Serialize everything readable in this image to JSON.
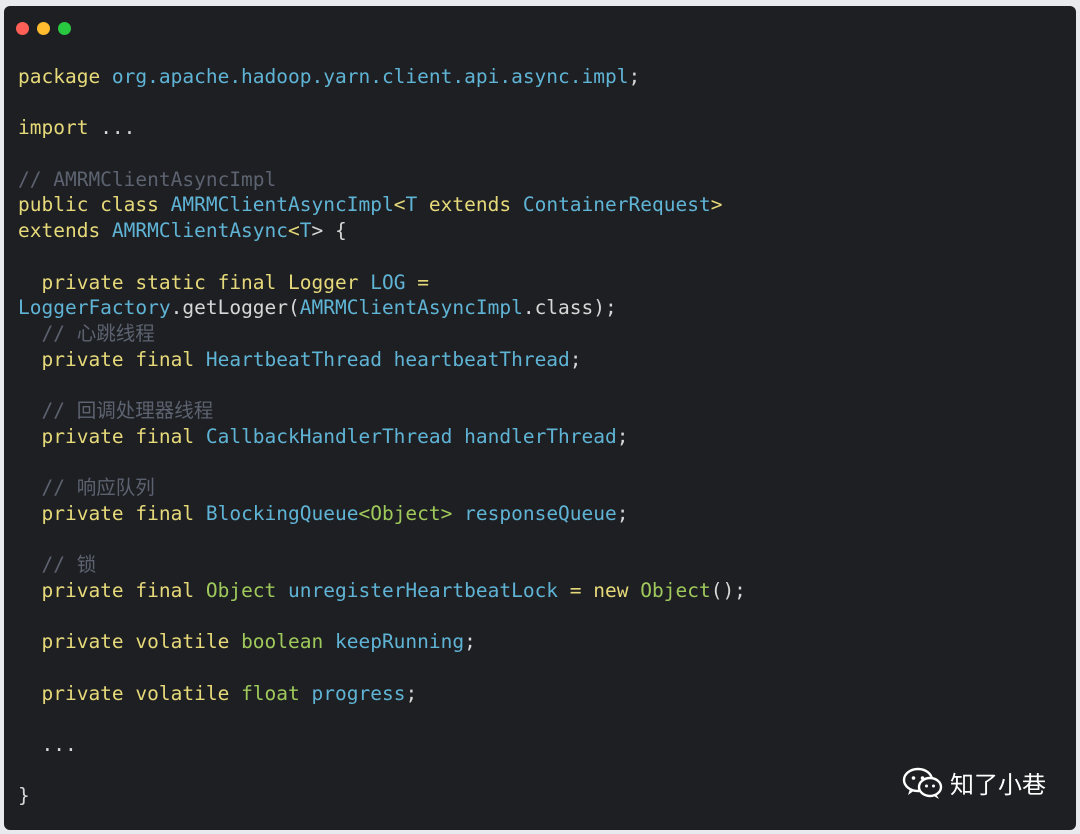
{
  "window": {
    "controls": [
      "close",
      "minimize",
      "zoom"
    ]
  },
  "code": {
    "lines": [
      [
        {
          "t": "package ",
          "c": "kw"
        },
        {
          "t": "org.apache.hadoop.yarn.client.api.async.impl",
          "c": "ty"
        },
        {
          "t": ";",
          "c": "pl"
        }
      ],
      [],
      [
        {
          "t": "import ",
          "c": "kw"
        },
        {
          "t": "...",
          "c": "pl"
        }
      ],
      [],
      [
        {
          "t": "// AMRMClientAsyncImpl",
          "c": "cm"
        }
      ],
      [
        {
          "t": "public class ",
          "c": "kw"
        },
        {
          "t": "AMRMClientAsyncImpl",
          "c": "ty"
        },
        {
          "t": "<",
          "c": "kw"
        },
        {
          "t": "T ",
          "c": "ty"
        },
        {
          "t": "extends ",
          "c": "kw"
        },
        {
          "t": "ContainerRequest",
          "c": "ty"
        },
        {
          "t": ">",
          "c": "kw"
        }
      ],
      [
        {
          "t": "extends ",
          "c": "kw"
        },
        {
          "t": "AMRMClientAsync",
          "c": "ty"
        },
        {
          "t": "<",
          "c": "kw"
        },
        {
          "t": "T",
          "c": "ty"
        },
        {
          "t": "> {",
          "c": "pl"
        }
      ],
      [],
      [
        {
          "t": "  private static final ",
          "c": "kw"
        },
        {
          "t": "Logger ",
          "c": "kw"
        },
        {
          "t": "LOG ",
          "c": "ty"
        },
        {
          "t": "=",
          "c": "kw"
        }
      ],
      [
        {
          "t": "LoggerFactory",
          "c": "ty"
        },
        {
          "t": ".getLogger(",
          "c": "pl"
        },
        {
          "t": "AMRMClientAsyncImpl",
          "c": "ty"
        },
        {
          "t": ".class);",
          "c": "pl"
        }
      ],
      [
        {
          "t": "  // 心跳线程",
          "c": "cm"
        }
      ],
      [
        {
          "t": "  private final ",
          "c": "kw"
        },
        {
          "t": "HeartbeatThread heartbeatThread",
          "c": "ty"
        },
        {
          "t": ";",
          "c": "pl"
        }
      ],
      [],
      [
        {
          "t": "  // 回调处理器线程",
          "c": "cm"
        }
      ],
      [
        {
          "t": "  private final ",
          "c": "kw"
        },
        {
          "t": "CallbackHandlerThread handlerThread",
          "c": "ty"
        },
        {
          "t": ";",
          "c": "pl"
        }
      ],
      [],
      [
        {
          "t": "  // 响应队列",
          "c": "cm"
        }
      ],
      [
        {
          "t": "  private final ",
          "c": "kw"
        },
        {
          "t": "BlockingQueue",
          "c": "ty"
        },
        {
          "t": "<Object> ",
          "c": "gr"
        },
        {
          "t": "responseQueue",
          "c": "ty"
        },
        {
          "t": ";",
          "c": "pl"
        }
      ],
      [],
      [
        {
          "t": "  // 锁",
          "c": "cm"
        }
      ],
      [
        {
          "t": "  private final ",
          "c": "kw"
        },
        {
          "t": "Object ",
          "c": "gr"
        },
        {
          "t": "unregisterHeartbeatLock ",
          "c": "ty"
        },
        {
          "t": "= ",
          "c": "kw"
        },
        {
          "t": "new ",
          "c": "kw"
        },
        {
          "t": "Object",
          "c": "gr"
        },
        {
          "t": "();",
          "c": "pl"
        }
      ],
      [],
      [
        {
          "t": "  private volatile ",
          "c": "kw"
        },
        {
          "t": "boolean ",
          "c": "gr"
        },
        {
          "t": "keepRunning",
          "c": "ty"
        },
        {
          "t": ";",
          "c": "pl"
        }
      ],
      [],
      [
        {
          "t": "  private volatile ",
          "c": "kw"
        },
        {
          "t": "float ",
          "c": "gr"
        },
        {
          "t": "progress",
          "c": "ty"
        },
        {
          "t": ";",
          "c": "pl"
        }
      ],
      [],
      [
        {
          "t": "  ...",
          "c": "pl"
        }
      ],
      [],
      [
        {
          "t": "}",
          "c": "pl"
        }
      ]
    ]
  },
  "watermark": {
    "text": "知了小巷",
    "icon": "wechat-icon"
  }
}
